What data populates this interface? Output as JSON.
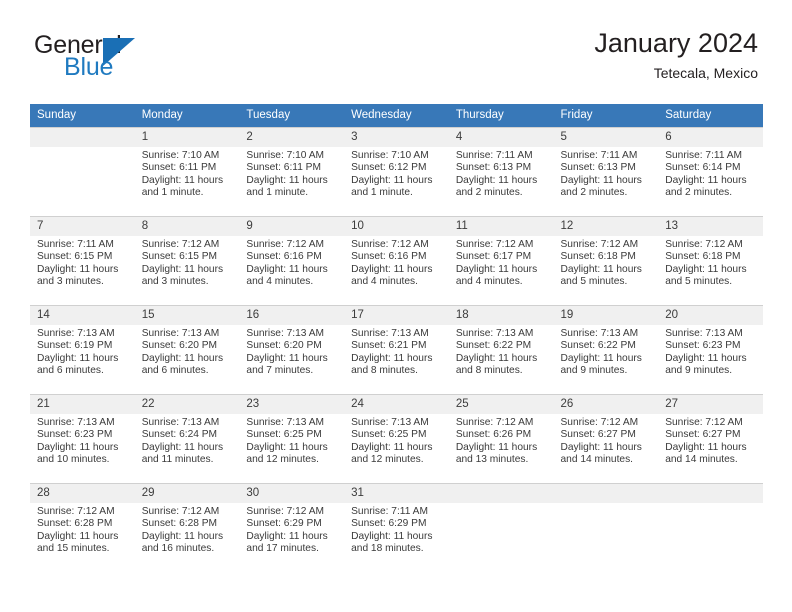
{
  "brand": {
    "name_part1": "General",
    "name_part2": "Blue",
    "triangle_color": "#1a6fb5",
    "text_color": "#231f20",
    "blue_color": "#1f7ac0"
  },
  "header": {
    "title": "January 2024",
    "subtitle": "Tetecala, Mexico"
  },
  "theme": {
    "header_row_bg": "#3878b8",
    "header_row_text": "#ffffff",
    "daynum_band_bg": "#f0f0f0",
    "grid_line": "#d0d0d0",
    "body_text": "#3a3a3a"
  },
  "weekday_headers": [
    "Sunday",
    "Monday",
    "Tuesday",
    "Wednesday",
    "Thursday",
    "Friday",
    "Saturday"
  ],
  "weeks": [
    [
      {
        "day": "",
        "sunrise": "",
        "sunset": "",
        "daylight_line1": "",
        "daylight_line2": ""
      },
      {
        "day": "1",
        "sunrise": "Sunrise: 7:10 AM",
        "sunset": "Sunset: 6:11 PM",
        "daylight_line1": "Daylight: 11 hours",
        "daylight_line2": "and 1 minute."
      },
      {
        "day": "2",
        "sunrise": "Sunrise: 7:10 AM",
        "sunset": "Sunset: 6:11 PM",
        "daylight_line1": "Daylight: 11 hours",
        "daylight_line2": "and 1 minute."
      },
      {
        "day": "3",
        "sunrise": "Sunrise: 7:10 AM",
        "sunset": "Sunset: 6:12 PM",
        "daylight_line1": "Daylight: 11 hours",
        "daylight_line2": "and 1 minute."
      },
      {
        "day": "4",
        "sunrise": "Sunrise: 7:11 AM",
        "sunset": "Sunset: 6:13 PM",
        "daylight_line1": "Daylight: 11 hours",
        "daylight_line2": "and 2 minutes."
      },
      {
        "day": "5",
        "sunrise": "Sunrise: 7:11 AM",
        "sunset": "Sunset: 6:13 PM",
        "daylight_line1": "Daylight: 11 hours",
        "daylight_line2": "and 2 minutes."
      },
      {
        "day": "6",
        "sunrise": "Sunrise: 7:11 AM",
        "sunset": "Sunset: 6:14 PM",
        "daylight_line1": "Daylight: 11 hours",
        "daylight_line2": "and 2 minutes."
      }
    ],
    [
      {
        "day": "7",
        "sunrise": "Sunrise: 7:11 AM",
        "sunset": "Sunset: 6:15 PM",
        "daylight_line1": "Daylight: 11 hours",
        "daylight_line2": "and 3 minutes."
      },
      {
        "day": "8",
        "sunrise": "Sunrise: 7:12 AM",
        "sunset": "Sunset: 6:15 PM",
        "daylight_line1": "Daylight: 11 hours",
        "daylight_line2": "and 3 minutes."
      },
      {
        "day": "9",
        "sunrise": "Sunrise: 7:12 AM",
        "sunset": "Sunset: 6:16 PM",
        "daylight_line1": "Daylight: 11 hours",
        "daylight_line2": "and 4 minutes."
      },
      {
        "day": "10",
        "sunrise": "Sunrise: 7:12 AM",
        "sunset": "Sunset: 6:16 PM",
        "daylight_line1": "Daylight: 11 hours",
        "daylight_line2": "and 4 minutes."
      },
      {
        "day": "11",
        "sunrise": "Sunrise: 7:12 AM",
        "sunset": "Sunset: 6:17 PM",
        "daylight_line1": "Daylight: 11 hours",
        "daylight_line2": "and 4 minutes."
      },
      {
        "day": "12",
        "sunrise": "Sunrise: 7:12 AM",
        "sunset": "Sunset: 6:18 PM",
        "daylight_line1": "Daylight: 11 hours",
        "daylight_line2": "and 5 minutes."
      },
      {
        "day": "13",
        "sunrise": "Sunrise: 7:12 AM",
        "sunset": "Sunset: 6:18 PM",
        "daylight_line1": "Daylight: 11 hours",
        "daylight_line2": "and 5 minutes."
      }
    ],
    [
      {
        "day": "14",
        "sunrise": "Sunrise: 7:13 AM",
        "sunset": "Sunset: 6:19 PM",
        "daylight_line1": "Daylight: 11 hours",
        "daylight_line2": "and 6 minutes."
      },
      {
        "day": "15",
        "sunrise": "Sunrise: 7:13 AM",
        "sunset": "Sunset: 6:20 PM",
        "daylight_line1": "Daylight: 11 hours",
        "daylight_line2": "and 6 minutes."
      },
      {
        "day": "16",
        "sunrise": "Sunrise: 7:13 AM",
        "sunset": "Sunset: 6:20 PM",
        "daylight_line1": "Daylight: 11 hours",
        "daylight_line2": "and 7 minutes."
      },
      {
        "day": "17",
        "sunrise": "Sunrise: 7:13 AM",
        "sunset": "Sunset: 6:21 PM",
        "daylight_line1": "Daylight: 11 hours",
        "daylight_line2": "and 8 minutes."
      },
      {
        "day": "18",
        "sunrise": "Sunrise: 7:13 AM",
        "sunset": "Sunset: 6:22 PM",
        "daylight_line1": "Daylight: 11 hours",
        "daylight_line2": "and 8 minutes."
      },
      {
        "day": "19",
        "sunrise": "Sunrise: 7:13 AM",
        "sunset": "Sunset: 6:22 PM",
        "daylight_line1": "Daylight: 11 hours",
        "daylight_line2": "and 9 minutes."
      },
      {
        "day": "20",
        "sunrise": "Sunrise: 7:13 AM",
        "sunset": "Sunset: 6:23 PM",
        "daylight_line1": "Daylight: 11 hours",
        "daylight_line2": "and 9 minutes."
      }
    ],
    [
      {
        "day": "21",
        "sunrise": "Sunrise: 7:13 AM",
        "sunset": "Sunset: 6:23 PM",
        "daylight_line1": "Daylight: 11 hours",
        "daylight_line2": "and 10 minutes."
      },
      {
        "day": "22",
        "sunrise": "Sunrise: 7:13 AM",
        "sunset": "Sunset: 6:24 PM",
        "daylight_line1": "Daylight: 11 hours",
        "daylight_line2": "and 11 minutes."
      },
      {
        "day": "23",
        "sunrise": "Sunrise: 7:13 AM",
        "sunset": "Sunset: 6:25 PM",
        "daylight_line1": "Daylight: 11 hours",
        "daylight_line2": "and 12 minutes."
      },
      {
        "day": "24",
        "sunrise": "Sunrise: 7:13 AM",
        "sunset": "Sunset: 6:25 PM",
        "daylight_line1": "Daylight: 11 hours",
        "daylight_line2": "and 12 minutes."
      },
      {
        "day": "25",
        "sunrise": "Sunrise: 7:12 AM",
        "sunset": "Sunset: 6:26 PM",
        "daylight_line1": "Daylight: 11 hours",
        "daylight_line2": "and 13 minutes."
      },
      {
        "day": "26",
        "sunrise": "Sunrise: 7:12 AM",
        "sunset": "Sunset: 6:27 PM",
        "daylight_line1": "Daylight: 11 hours",
        "daylight_line2": "and 14 minutes."
      },
      {
        "day": "27",
        "sunrise": "Sunrise: 7:12 AM",
        "sunset": "Sunset: 6:27 PM",
        "daylight_line1": "Daylight: 11 hours",
        "daylight_line2": "and 14 minutes."
      }
    ],
    [
      {
        "day": "28",
        "sunrise": "Sunrise: 7:12 AM",
        "sunset": "Sunset: 6:28 PM",
        "daylight_line1": "Daylight: 11 hours",
        "daylight_line2": "and 15 minutes."
      },
      {
        "day": "29",
        "sunrise": "Sunrise: 7:12 AM",
        "sunset": "Sunset: 6:28 PM",
        "daylight_line1": "Daylight: 11 hours",
        "daylight_line2": "and 16 minutes."
      },
      {
        "day": "30",
        "sunrise": "Sunrise: 7:12 AM",
        "sunset": "Sunset: 6:29 PM",
        "daylight_line1": "Daylight: 11 hours",
        "daylight_line2": "and 17 minutes."
      },
      {
        "day": "31",
        "sunrise": "Sunrise: 7:11 AM",
        "sunset": "Sunset: 6:29 PM",
        "daylight_line1": "Daylight: 11 hours",
        "daylight_line2": "and 18 minutes."
      },
      {
        "day": "",
        "sunrise": "",
        "sunset": "",
        "daylight_line1": "",
        "daylight_line2": ""
      },
      {
        "day": "",
        "sunrise": "",
        "sunset": "",
        "daylight_line1": "",
        "daylight_line2": ""
      },
      {
        "day": "",
        "sunrise": "",
        "sunset": "",
        "daylight_line1": "",
        "daylight_line2": ""
      }
    ]
  ]
}
